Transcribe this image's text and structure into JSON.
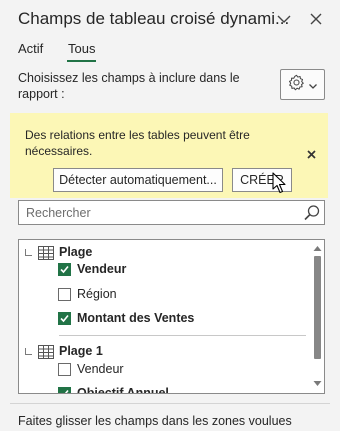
{
  "header": {
    "title": "Champs de tableau croisé dynami...",
    "options_icon": "chevron-down-icon",
    "close_icon": "close-icon"
  },
  "tabs": [
    {
      "label": "Actif",
      "selected": false
    },
    {
      "label": "Tous",
      "selected": true
    }
  ],
  "instructions": "Choisissez les champs à inclure dans le rapport :",
  "settings": {
    "icon": "gear-icon",
    "dropdown_icon": "chevron-down-icon"
  },
  "banner": {
    "message": "Des relations entre les tables peuvent être nécessaires.",
    "detect_label": "Détecter automatiquement...",
    "create_label": "CRÉER",
    "background": "#fcf7b6"
  },
  "search": {
    "placeholder": "Rechercher",
    "icon": "search-icon"
  },
  "field_list": {
    "tables": [
      {
        "name": "Plage",
        "fields": [
          {
            "label": "Vendeur",
            "checked": true
          },
          {
            "label": "Région",
            "checked": false
          },
          {
            "label": "Montant des Ventes",
            "checked": true
          }
        ]
      },
      {
        "name": "Plage 1",
        "fields": [
          {
            "label": "Vendeur",
            "checked": false
          },
          {
            "label": "Objectif Annuel",
            "checked": true
          }
        ]
      }
    ]
  },
  "footer": "Faites glisser les champs dans les zones voulues",
  "colors": {
    "accent": "#217346",
    "pane_background": "#f3f3f3"
  }
}
